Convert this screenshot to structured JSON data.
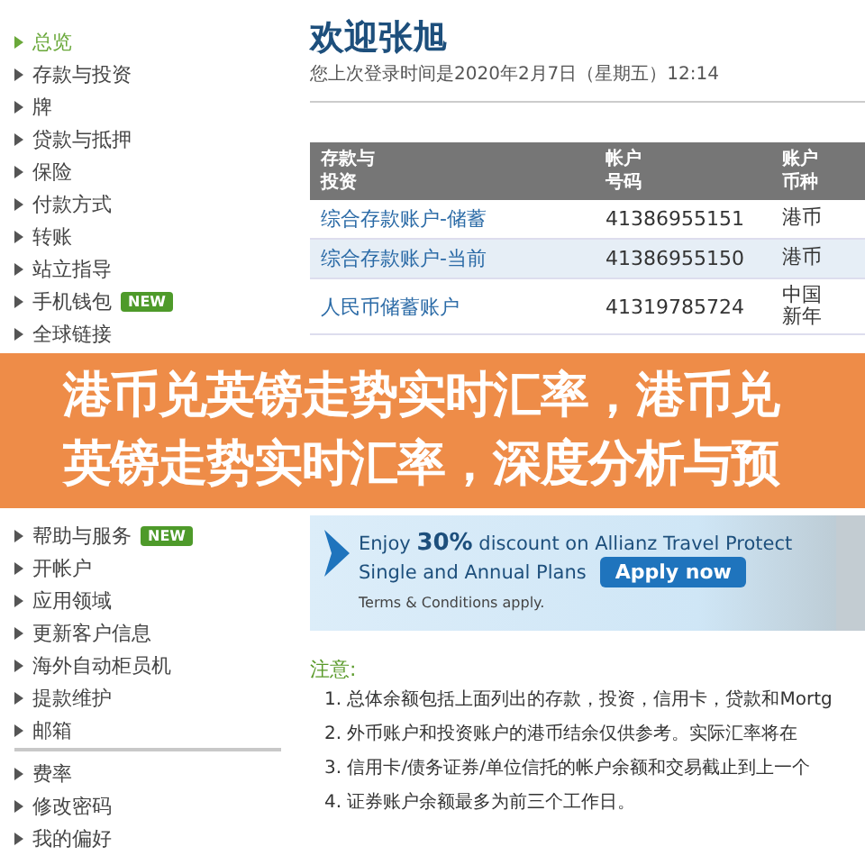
{
  "sidebar": {
    "top_groups": [
      [
        {
          "label": "总览",
          "selected": true
        },
        {
          "label": "存款与投资",
          "selected": false
        },
        {
          "label": "牌",
          "selected": false
        },
        {
          "label": "贷款与抵押",
          "selected": false
        },
        {
          "label": "保险",
          "selected": false
        },
        {
          "label": "付款方式",
          "selected": false
        },
        {
          "label": "转账",
          "selected": false
        },
        {
          "label": "站立指导",
          "selected": false
        },
        {
          "label": "手机钱包",
          "selected": false,
          "badge": "NEW"
        },
        {
          "label": "全球链接",
          "selected": false
        }
      ]
    ],
    "bottom_groups": [
      [
        {
          "label": "帮助与服务",
          "selected": false,
          "badge": "NEW"
        },
        {
          "label": "开帐户",
          "selected": false
        },
        {
          "label": "应用领域",
          "selected": false
        },
        {
          "label": "更新客户信息",
          "selected": false
        },
        {
          "label": "海外自动柜员机",
          "selected": false
        },
        {
          "label": "提款维护",
          "selected": false
        },
        {
          "label": "邮箱",
          "selected": false
        }
      ],
      [
        {
          "label": "费率",
          "selected": false
        },
        {
          "label": "修改密码",
          "selected": false
        },
        {
          "label": "我的偏好",
          "selected": false
        }
      ]
    ]
  },
  "welcome": {
    "title": "欢迎张旭",
    "last_login": "您上次登录时间是2020年2月7日（星期五）12:14"
  },
  "table": {
    "columns": [
      "存款与投资",
      "帐户号码",
      "账户币种"
    ],
    "rows": [
      [
        "综合存款账户-储蓄",
        "41386955151",
        "港币"
      ],
      [
        "综合存款账户-当前",
        "41386955150",
        "港币"
      ],
      [
        "人民币储蓄账户",
        "41319785724",
        "中国新年"
      ]
    ]
  },
  "banner": {
    "text": "港币兑英镑走势实时汇率，港币兑英镑走势实时汇率，深度分析与预"
  },
  "ad": {
    "headline": "Enjoy **30%** discount on Allianz Travel Protect",
    "subline": "Single and Annual Plans",
    "button": "Apply now",
    "terms": "Terms & Conditions apply."
  },
  "notes": {
    "title": "注意:",
    "items": [
      "1. 总体余额包括上面列出的存款，投资，信用卡，贷款和Mortg",
      "2. 外币账户和投资账户的港币结余仅供参考。实际汇率将在",
      "3. 信用卡/债务证券/单位信托的帐户余额和交易截止到上一个",
      "4. 证券账户余额最多为前三个工作日。"
    ]
  }
}
